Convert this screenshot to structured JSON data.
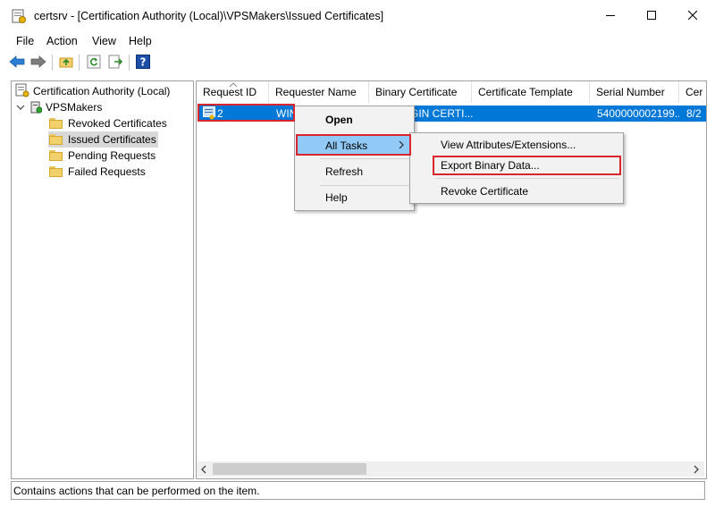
{
  "window": {
    "title": "certsrv - [Certification Authority (Local)\\VPSMakers\\Issued Certificates]",
    "minimize_icon": "minimize-icon",
    "maximize_icon": "maximize-icon",
    "close_icon": "close-icon"
  },
  "menubar": {
    "file": "File",
    "action": "Action",
    "view": "View",
    "help": "Help"
  },
  "toolbar": {
    "buttons": [
      "back-arrow-icon",
      "forward-arrow-icon",
      "up-folder-icon",
      "refresh-icon",
      "export-list-icon",
      "help-icon"
    ]
  },
  "tree": {
    "root": "Certification Authority (Local)",
    "ca": "VPSMakers",
    "items": [
      "Revoked Certificates",
      "Issued Certificates",
      "Pending Requests",
      "Failed Requests"
    ],
    "selected": "Issued Certificates"
  },
  "list": {
    "columns": [
      "Request ID",
      "Requester Name",
      "Binary Certificate",
      "Certificate Template",
      "Serial Number",
      "Cer"
    ],
    "sort_column": "Request ID",
    "rows": [
      {
        "request_id": "2",
        "requester_name": "WIN",
        "binary_certificate": "GIN CERTI...",
        "serial_number": "5400000002199...",
        "cert_date": "8/2"
      }
    ]
  },
  "context_menu": {
    "items": [
      "Open",
      "All Tasks",
      "Refresh",
      "Help"
    ],
    "highlighted": "All Tasks"
  },
  "submenu": {
    "items": [
      "View Attributes/Extensions...",
      "Export Binary Data...",
      "Revoke Certificate"
    ],
    "highlighted": "Export Binary Data..."
  },
  "status": {
    "text": "Contains actions that can be performed on the item."
  },
  "colors": {
    "selection": "#0078d7",
    "menu_highlight": "#91c9f7",
    "annotation": "#d8262c"
  }
}
